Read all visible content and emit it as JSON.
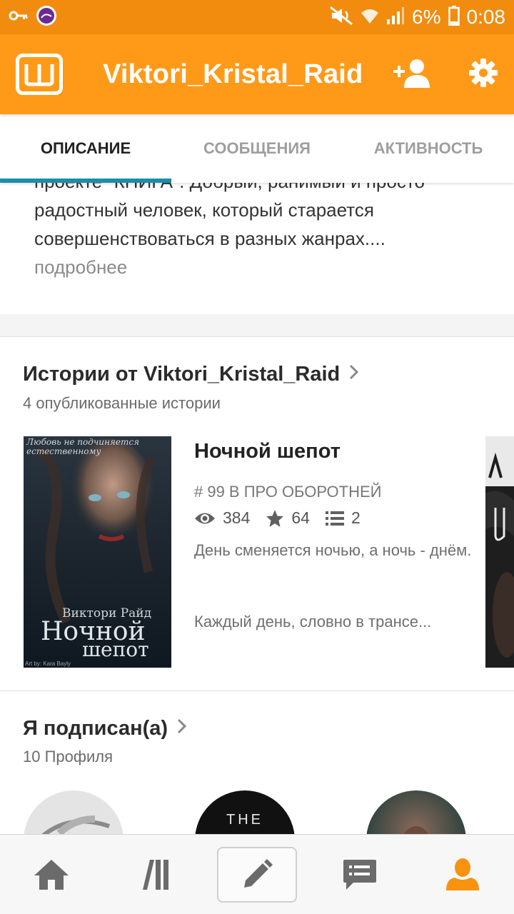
{
  "status_bar": {
    "battery": "6%",
    "time": "0:08",
    "icons": [
      "key-icon",
      "notification-app-icon",
      "mute-icon",
      "wifi-icon",
      "signal-icon",
      "battery-icon"
    ]
  },
  "app_bar": {
    "title": "Viktori_Kristal_Raid",
    "logo_letter": "Ш",
    "actions": [
      "add-friend-icon",
      "settings-icon"
    ],
    "color": "#ff9a19"
  },
  "tabs": [
    {
      "label": "ОПИСАНИЕ",
      "active": true
    },
    {
      "label": "СООБЩЕНИЯ",
      "active": false
    },
    {
      "label": "АКТИВНОСТЬ",
      "active": false
    }
  ],
  "description": {
    "lines": [
      "проекте \"КНИГА\". Добрый, ранимый и просто",
      "радостный человек, который старается",
      "совершенствоваться в разных жанрах...."
    ],
    "more_link": "подробнее"
  },
  "stories": {
    "title": "Истории от Viktori_Kristal_Raid",
    "subtitle": "4 опубликованные истории",
    "items": [
      {
        "title": "Ночной шепот",
        "rank": "# 99 В ПРО ОБОРОТНЕЙ",
        "views": "384",
        "votes": "64",
        "parts": "2",
        "blurb_1": "День сменяется ночью, а ночь - днём.",
        "blurb_2": "Каждый день, словно в трансе...",
        "cover": {
          "tagline": "Любовь не подчиняется естественному",
          "author": "Виктори Райд",
          "title_line1": "Ночной",
          "title_line2": "шепот",
          "credit": "Art by: Kara Bayly"
        }
      }
    ]
  },
  "following": {
    "title": "Я подписан(а)",
    "subtitle": "10 Профиля",
    "avatars": [
      {
        "name": "profile-avatar-1",
        "text": ""
      },
      {
        "name": "profile-avatar-2",
        "text": "THE"
      },
      {
        "name": "profile-avatar-3",
        "text": ""
      }
    ]
  },
  "bottom_nav": [
    {
      "name": "home-icon",
      "active": false
    },
    {
      "name": "library-icon",
      "active": false
    },
    {
      "name": "write-icon",
      "active": false
    },
    {
      "name": "messages-icon",
      "active": false
    },
    {
      "name": "profile-icon",
      "active": true
    }
  ],
  "colors": {
    "accent": "#ff9a19",
    "status_bar": "#f28c0e",
    "tab_indicator": "#1b8ea8",
    "active_nav": "#f7930e"
  }
}
